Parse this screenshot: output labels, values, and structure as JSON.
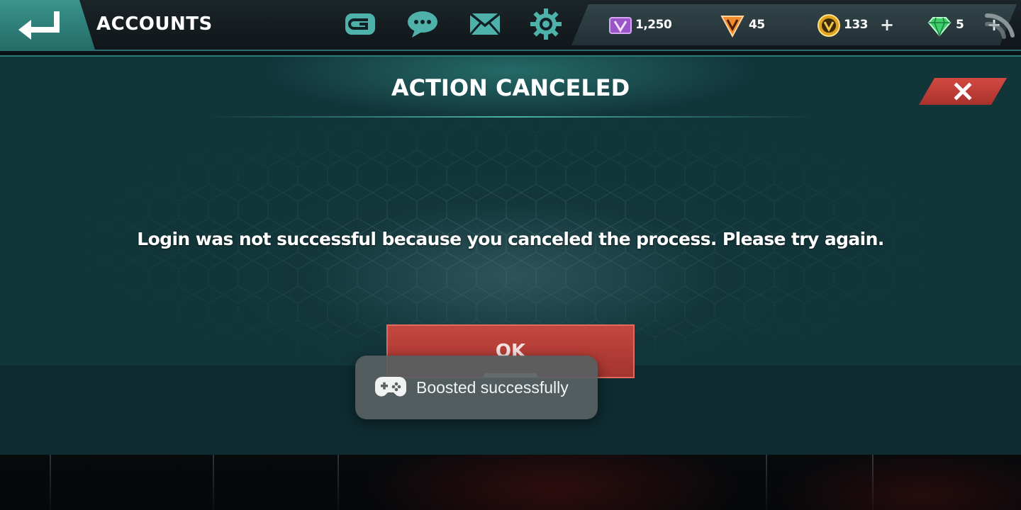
{
  "header": {
    "title": "ACCOUNTS",
    "back_icon": "back-arrow-icon",
    "icons": [
      "gameloft-icon",
      "chat-icon",
      "mail-icon",
      "settings-gear-icon"
    ]
  },
  "currencies": [
    {
      "name": "purple-credits",
      "icon": "purple-v-chip-icon",
      "value": "1,250",
      "has_plus": false
    },
    {
      "name": "orange-tokens",
      "icon": "orange-v-shield-icon",
      "value": "45",
      "has_plus": false
    },
    {
      "name": "gold-coins",
      "icon": "gold-v-coin-icon",
      "value": "133",
      "has_plus": true
    },
    {
      "name": "gems",
      "icon": "green-gem-icon",
      "value": "5",
      "has_plus": true
    }
  ],
  "plus_label": "+",
  "dialog": {
    "title": "ACTION CANCELED",
    "message": "Login was not successful because you canceled the process. Please try again.",
    "ok_label": "OK",
    "close_icon": "close-x-icon"
  },
  "toast": {
    "text": "Boosted successfully",
    "icon": "gamepad-icon"
  },
  "colors": {
    "accent_teal": "#2a7a77",
    "danger_red": "#c4473f",
    "panel": "#12353a"
  }
}
